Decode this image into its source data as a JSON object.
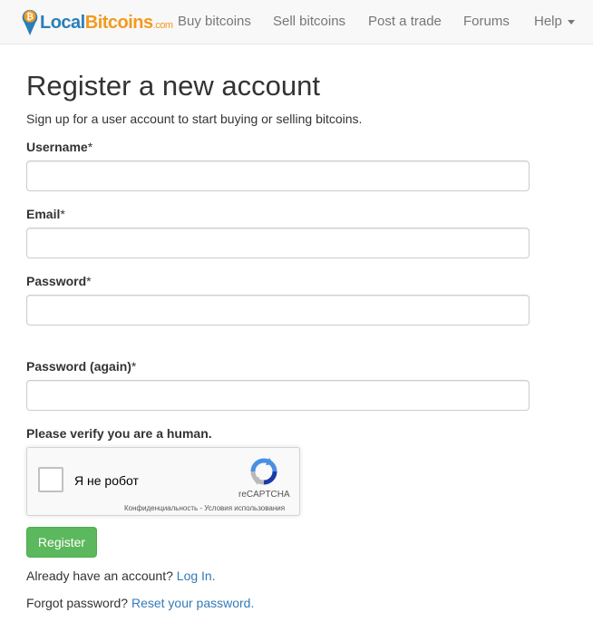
{
  "navbar": {
    "brand": {
      "part1": "Local",
      "part2": "Bitcoins",
      "part3": ".com"
    },
    "items": [
      {
        "label": "Buy bitcoins"
      },
      {
        "label": "Sell bitcoins"
      },
      {
        "label": "Post a trade"
      },
      {
        "label": "Forums"
      },
      {
        "label": "Help"
      }
    ]
  },
  "form": {
    "title": "Register a new account",
    "subtitle": "Sign up for a user account to start buying or selling bitcoins.",
    "fields": [
      {
        "label": "Username",
        "required_mark": "*",
        "value": ""
      },
      {
        "label": "Email",
        "required_mark": "*",
        "value": ""
      },
      {
        "label": "Password",
        "required_mark": "*",
        "value": ""
      },
      {
        "label": "Password (again)",
        "required_mark": "*",
        "value": ""
      }
    ],
    "verify_label": "Please verify you are a human.",
    "captcha": {
      "checkbox_label": "Я не робот",
      "brand": "reCAPTCHA",
      "terms": "Конфиденциальность - Условия использования"
    },
    "register_label": "Register",
    "login_prompt": "Already have an account?",
    "login_link": "Log In.",
    "forgot_prompt": "Forgot password?",
    "forgot_link": "Reset your password."
  },
  "colors": {
    "brand_blue": "#2a7fb8",
    "brand_orange": "#f39a1e",
    "link": "#337ab7",
    "success": "#5cb85c"
  }
}
